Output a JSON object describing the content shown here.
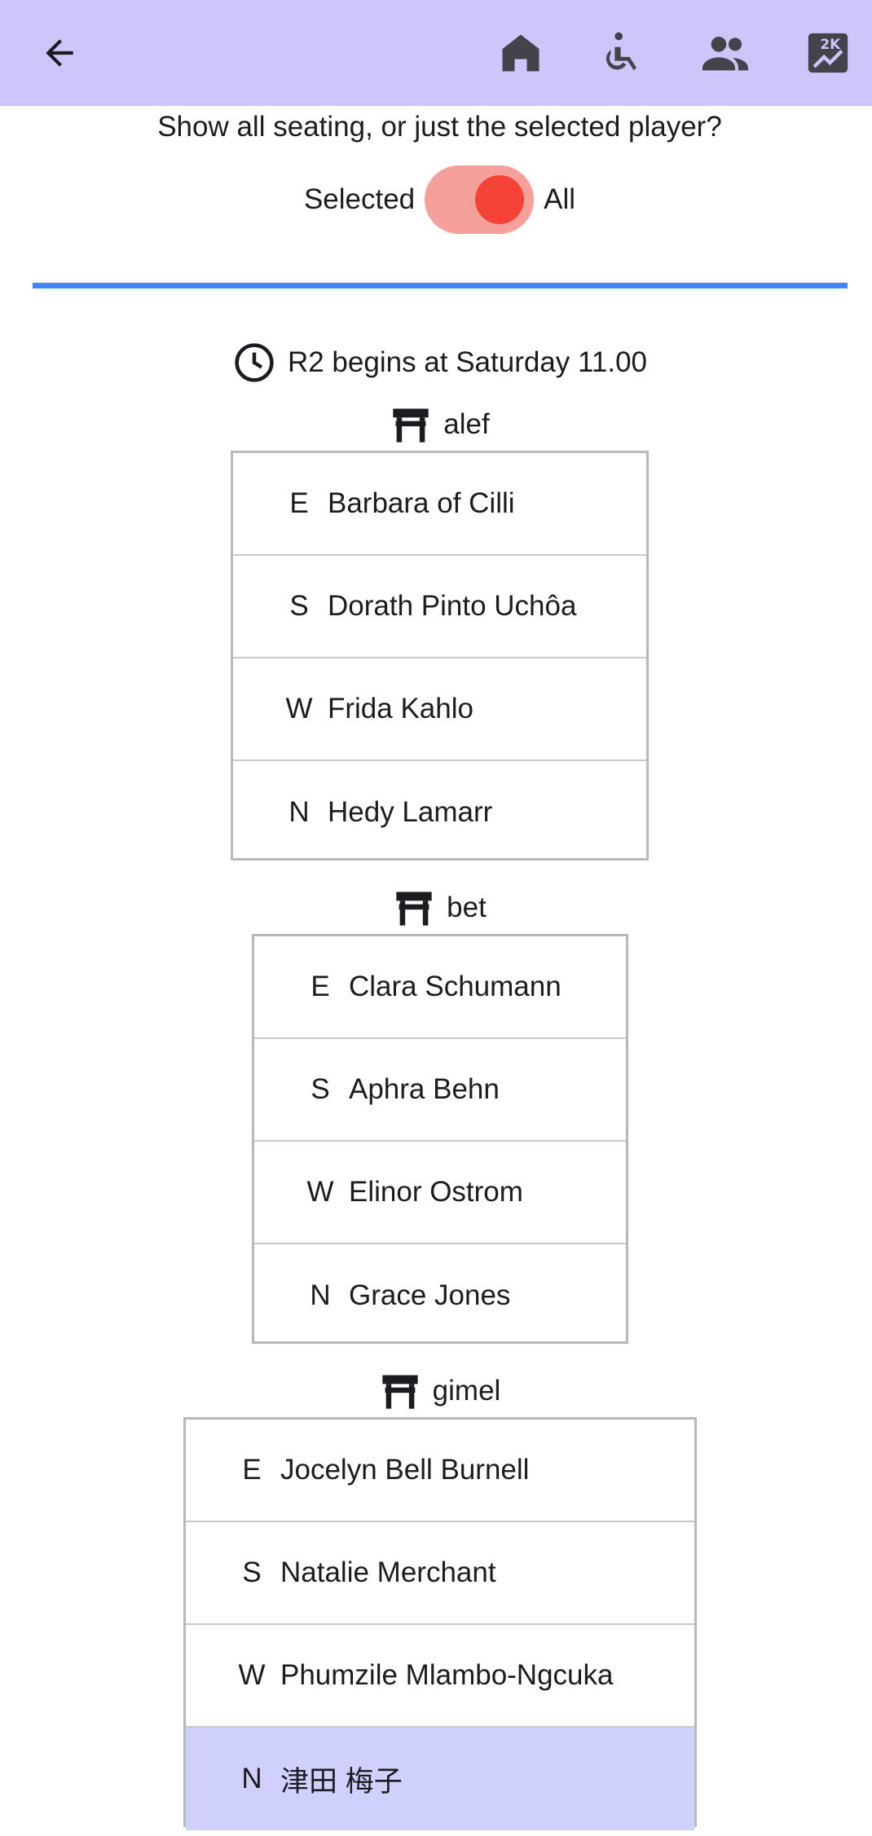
{
  "appbar": {
    "back_icon": "arrow-back-icon",
    "actions": [
      {
        "icon": "home-icon"
      },
      {
        "icon": "accessible-icon"
      },
      {
        "icon": "group-icon"
      },
      {
        "icon": "2k-chart-icon",
        "text": "2K"
      }
    ]
  },
  "filter": {
    "question": "Show all seating, or just the selected player?",
    "left_label": "Selected",
    "right_label": "All",
    "value": "All"
  },
  "round": {
    "icon": "clock-icon",
    "text": "R2 begins at Saturday 11.00"
  },
  "tables": [
    {
      "name": "alef",
      "seats": [
        {
          "dir": "E",
          "player": "Barbara of Cilli"
        },
        {
          "dir": "S",
          "player": "Dorath Pinto Uchôa"
        },
        {
          "dir": "W",
          "player": "Frida Kahlo"
        },
        {
          "dir": "N",
          "player": "Hedy Lamarr"
        }
      ]
    },
    {
      "name": "bet",
      "seats": [
        {
          "dir": "E",
          "player": "Clara Schumann"
        },
        {
          "dir": "S",
          "player": "Aphra Behn"
        },
        {
          "dir": "W",
          "player": "Elinor Ostrom"
        },
        {
          "dir": "N",
          "player": "Grace Jones"
        }
      ]
    },
    {
      "name": "gimel",
      "seats": [
        {
          "dir": "E",
          "player": "Jocelyn Bell Burnell"
        },
        {
          "dir": "S",
          "player": "Natalie Merchant"
        },
        {
          "dir": "W",
          "player": "Phumzile Mlambo-Ngcuka"
        },
        {
          "dir": "N",
          "player": "津田 梅子",
          "selected": true
        }
      ]
    }
  ],
  "colors": {
    "appbar": "#cfc5fb",
    "switch_thumb": "#f44336",
    "switch_track": "#f5a09a",
    "divider": "#4285f4",
    "selected_row": "#cfd1fc"
  }
}
